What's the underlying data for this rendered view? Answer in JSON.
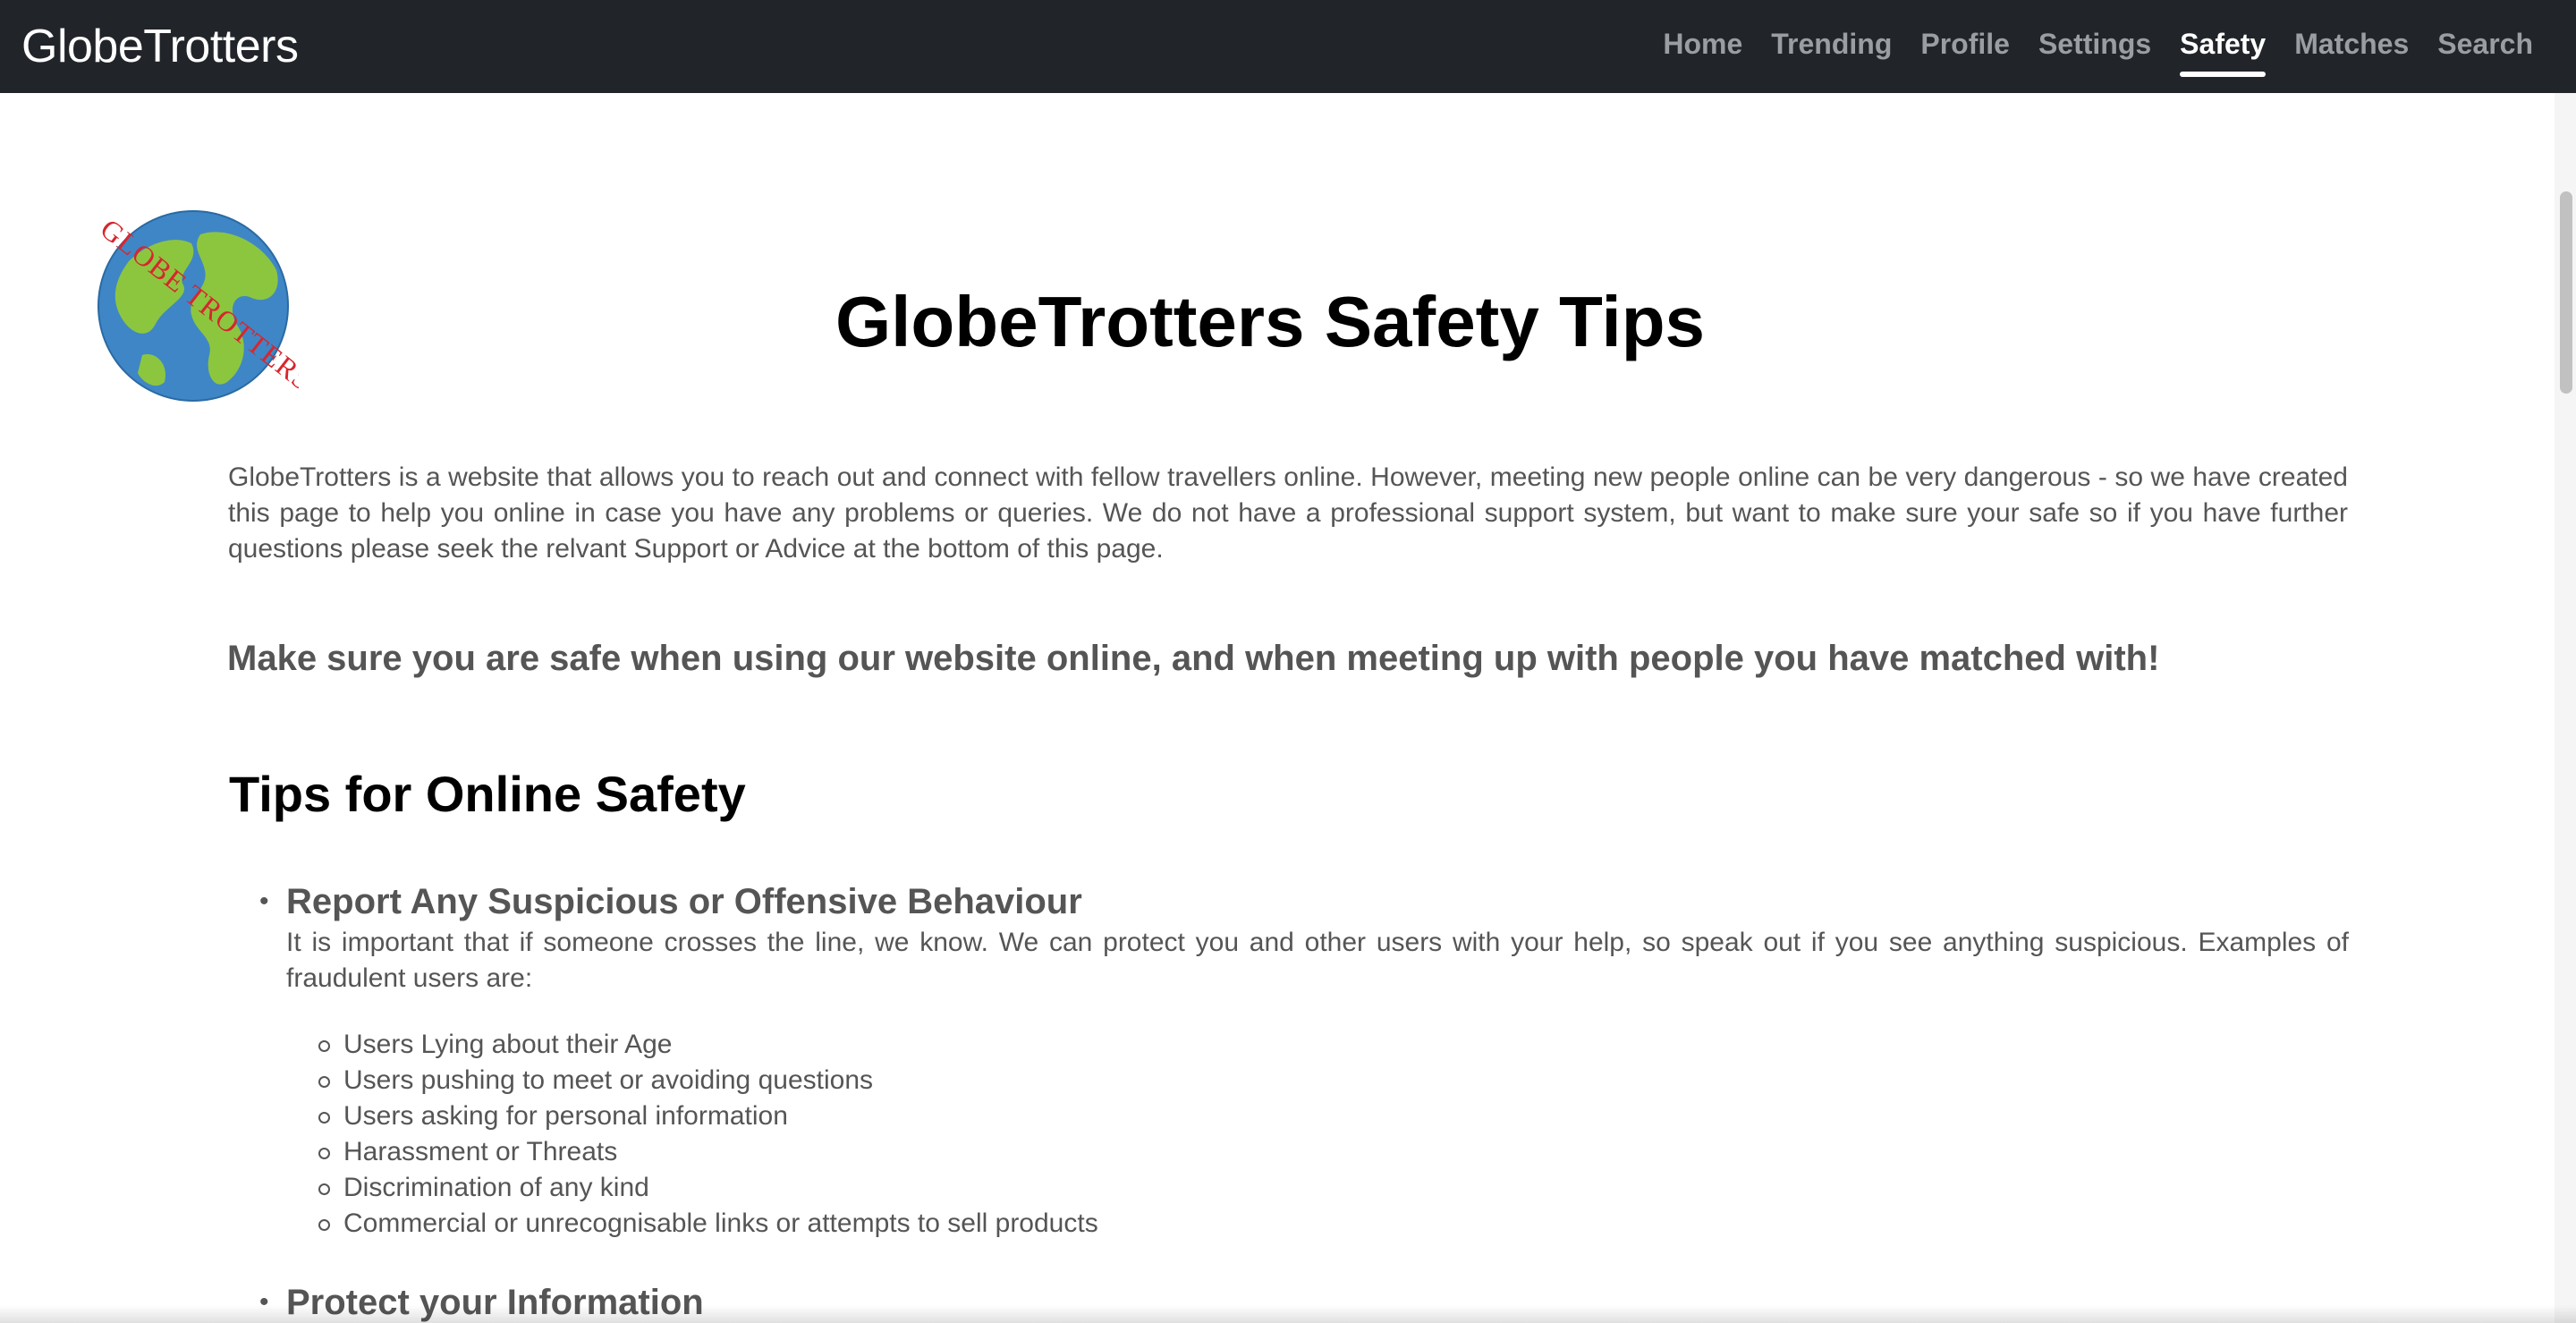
{
  "navbar": {
    "brand": "GlobeTrotters",
    "links": [
      {
        "label": "Home",
        "active": false
      },
      {
        "label": "Trending",
        "active": false
      },
      {
        "label": "Profile",
        "active": false
      },
      {
        "label": "Settings",
        "active": false
      },
      {
        "label": "Safety",
        "active": true
      },
      {
        "label": "Matches",
        "active": false
      },
      {
        "label": "Search",
        "active": false
      }
    ]
  },
  "logo": {
    "text": "GLOBE TROTTERS",
    "icon": "globe-icon"
  },
  "main": {
    "title": "GlobeTrotters Safety Tips",
    "intro": "GlobeTrotters is a website that allows you to reach out and connect with fellow travellers online. However, meeting new people online can be very dangerous - so we have created this page to help you online in case you have any problems or queries. We do not have a professional support system, but want to make sure your safe so if you have further questions please seek the relvant Support or Advice at the bottom of this page.",
    "subhead": "Make sure you are safe when using our website online, and when meeting up with people you have matched with!",
    "section_title": "Tips for Online Safety",
    "tips": [
      {
        "title": "Report Any Suspicious or Offensive Behaviour",
        "body": "It is important that if someone crosses the line, we know. We can protect you and other users with your help, so speak out if you see anything suspicious. Examples of fraudulent users are:",
        "items": [
          "Users Lying about their Age",
          "Users pushing to meet or avoiding questions",
          "Users asking for personal information",
          "Harassment or Threats",
          "Discrimination of any kind",
          "Commercial or unrecognisable links or attempts to sell products"
        ]
      },
      {
        "title": "Protect your Information"
      }
    ]
  },
  "colors": {
    "navbar_bg": "#212529",
    "nav_inactive": "#9a9ea3",
    "nav_active": "#ffffff",
    "body_text": "#555555",
    "heading_text": "#000000",
    "globe_land": "#8cc63f",
    "globe_water": "#3f86c6",
    "logo_text": "#d7262e"
  }
}
